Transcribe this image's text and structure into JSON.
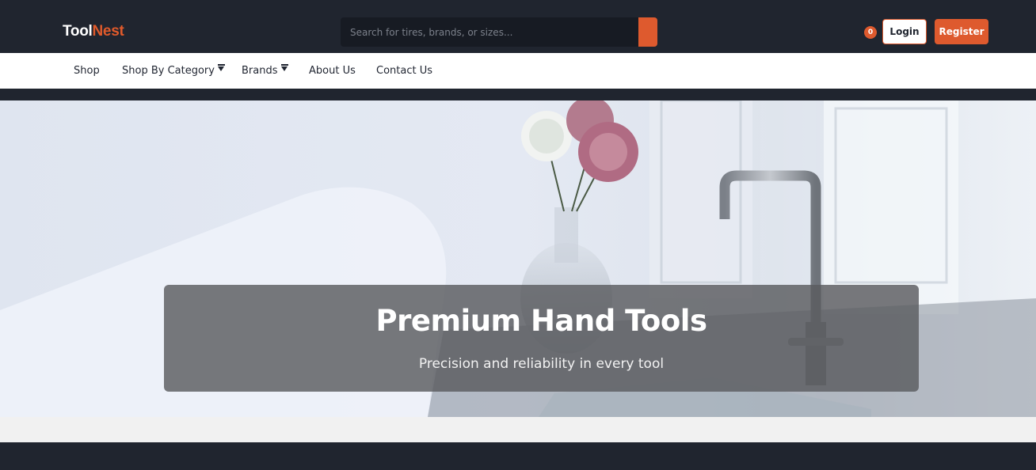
{
  "header": {
    "logo_part1": "Tool",
    "logo_part2": "Nest",
    "search_placeholder": "Search for tires, brands, or sizes...",
    "cart_count": "0",
    "login_label": "Login",
    "register_label": "Register"
  },
  "nav": {
    "items": [
      {
        "label": "Shop"
      },
      {
        "label": "Shop By Category"
      },
      {
        "label": "Brands"
      },
      {
        "label": "About Us"
      },
      {
        "label": "Contact Us"
      }
    ]
  },
  "hero": {
    "title": "Premium Hand Tools",
    "subtitle": "Precision and reliability in every tool"
  },
  "colors": {
    "accent": "#de5a2e",
    "dark": "#20252f",
    "nav_bg": "#ffffff"
  },
  "icons": [
    "search-icon",
    "cart-badge",
    "chevron-down-icon"
  ]
}
